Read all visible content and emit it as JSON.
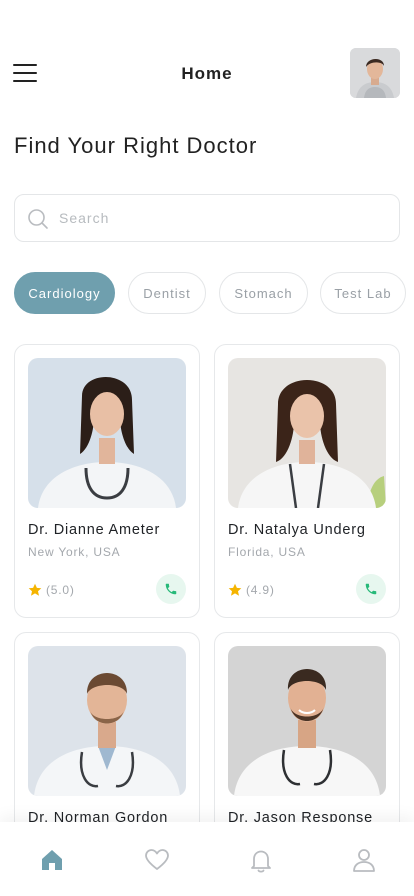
{
  "header": {
    "title": "Home"
  },
  "page_title": "Find Your Right Doctor",
  "search": {
    "placeholder": "Search",
    "value": ""
  },
  "categories": [
    {
      "label": "Cardiology",
      "active": true
    },
    {
      "label": "Dentist",
      "active": false
    },
    {
      "label": "Stomach",
      "active": false
    },
    {
      "label": "Test Lab",
      "active": false
    }
  ],
  "doctors": [
    {
      "name": "Dr. Dianne Ameter",
      "location": "New York, USA",
      "rating": "(5.0)"
    },
    {
      "name": "Dr. Natalya Underg",
      "location": "Florida, USA",
      "rating": "(4.9)"
    },
    {
      "name": "Dr. Norman Gordon"
    },
    {
      "name": "Dr. Jason Response"
    }
  ],
  "bottom_nav": [
    {
      "icon": "home-icon",
      "active": true
    },
    {
      "icon": "heart-icon",
      "active": false
    },
    {
      "icon": "bell-icon",
      "active": false
    },
    {
      "icon": "user-icon",
      "active": false
    }
  ],
  "colors": {
    "accent": "#6f9fae",
    "star": "#f5b400",
    "call_bg": "#e7f7ef",
    "call_icon": "#27b979",
    "muted_text": "#a4a8ad",
    "nav_inactive": "#b9bcc0"
  }
}
